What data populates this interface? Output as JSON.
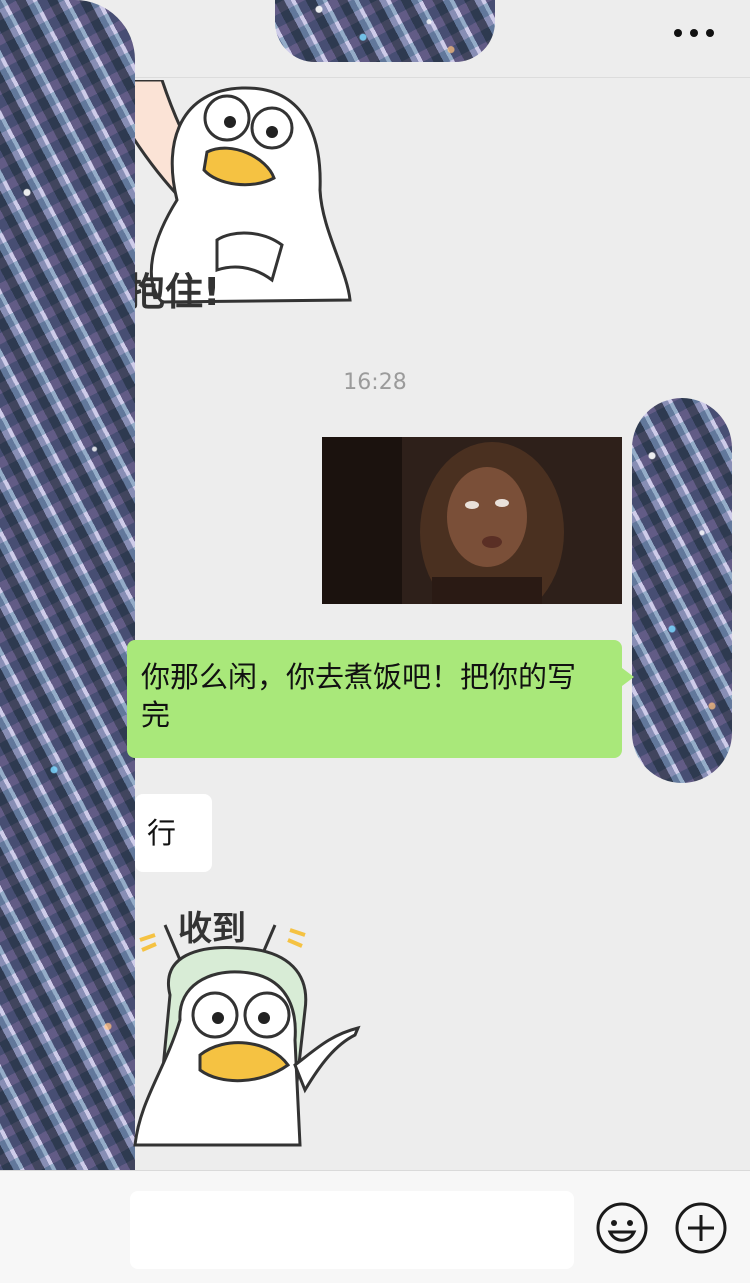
{
  "header": {
    "more_icon": "more-dots-icon"
  },
  "messages": {
    "sticker_hug_text": "抱住!",
    "timestamp": "16:28",
    "green_bubble_text": "你那么闲，你去煮饭吧！把你的写完",
    "white_bubble_text": "行",
    "sticker_got_text": "收到"
  },
  "input_bar": {
    "input_value": "",
    "emoji_icon": "smiley-face-icon",
    "plus_icon": "plus-circle-icon"
  },
  "colors": {
    "background": "#ededed",
    "sent_bubble": "#a9e87a",
    "received_bubble": "#ffffff"
  }
}
